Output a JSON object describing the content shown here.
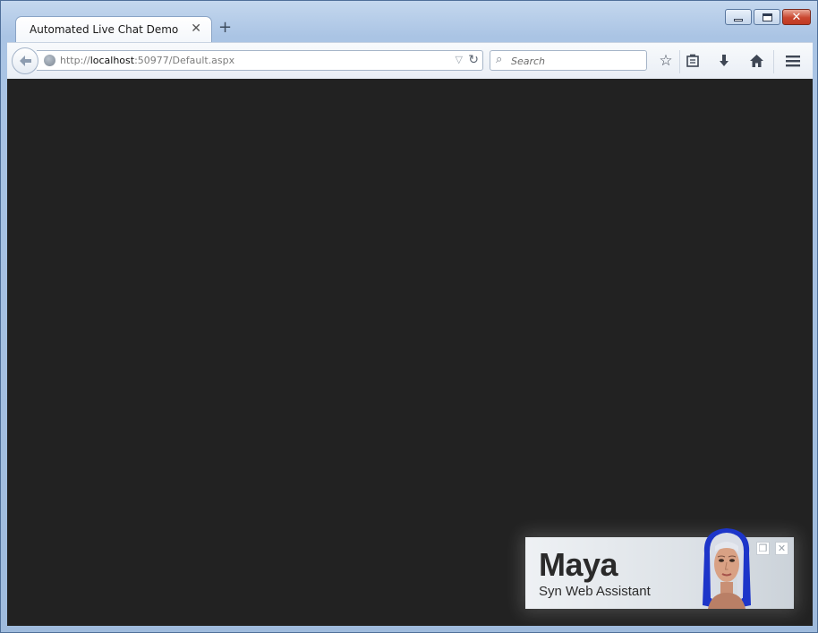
{
  "browser": {
    "tab_title": "Automated Live Chat Demo",
    "tab_close_glyph": "✕",
    "new_tab_glyph": "+",
    "url_scheme": "http://",
    "url_host": "localhost",
    "url_rest": ":50977/Default.aspx",
    "search_placeholder": "Search",
    "icons": [
      "back-arrow-icon",
      "globe-icon",
      "dropmarker-icon",
      "reload-icon",
      "search-icon",
      "bookmark-star-icon",
      "reading-list-icon",
      "download-icon",
      "home-icon",
      "menu-icon",
      "minimize-icon",
      "maximize-icon",
      "close-icon"
    ]
  },
  "page": {
    "background": "#222222"
  },
  "chat_widget": {
    "agent_name": "Maya",
    "agent_subtitle": "Syn Web Assistant",
    "restore_glyph": "❐",
    "close_glyph": "✕"
  },
  "colors": {
    "window_frame": "#aac4e4",
    "caption_close": "#c9462f",
    "content_bg": "#222222",
    "avatar_hair": "#1d35c9"
  }
}
